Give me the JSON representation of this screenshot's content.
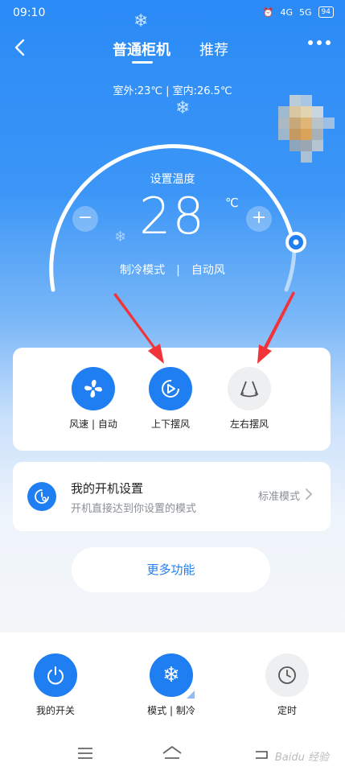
{
  "status_bar": {
    "time": "09:10",
    "signal_1": "4G",
    "signal_2": "5G",
    "battery": "94"
  },
  "nav": {
    "active_tab": "普通柜机",
    "other_tab": "推荐"
  },
  "temps": {
    "line": "室外:23℃ | 室内:26.5℃"
  },
  "dial": {
    "set_label": "设置温度",
    "temperature": "28",
    "unit": "℃",
    "minus": "−",
    "plus": "+",
    "mode": "制冷模式",
    "separator": "|",
    "fan": "自动风"
  },
  "controls": [
    {
      "label": "风速 | 自动",
      "icon": "fan-icon"
    },
    {
      "label": "上下摆风",
      "icon": "vertical-swing-icon"
    },
    {
      "label": "左右摆风",
      "icon": "horizontal-swing-icon"
    }
  ],
  "power_settings": {
    "title": "我的开机设置",
    "subtitle": "开机直接达到你设置的模式",
    "mode": "标准模式"
  },
  "more_button": "更多功能",
  "bottom": [
    {
      "label": "我的开关",
      "icon": "power-icon"
    },
    {
      "label": "模式 | 制冷",
      "icon": "snowflake-icon"
    },
    {
      "label": "定时",
      "icon": "clock-icon"
    }
  ],
  "watermark": "Baidu 经验",
  "colors": {
    "primary": "#1f7ff2",
    "hero_top": "#2a8af6",
    "arrow": "#f0343a"
  }
}
